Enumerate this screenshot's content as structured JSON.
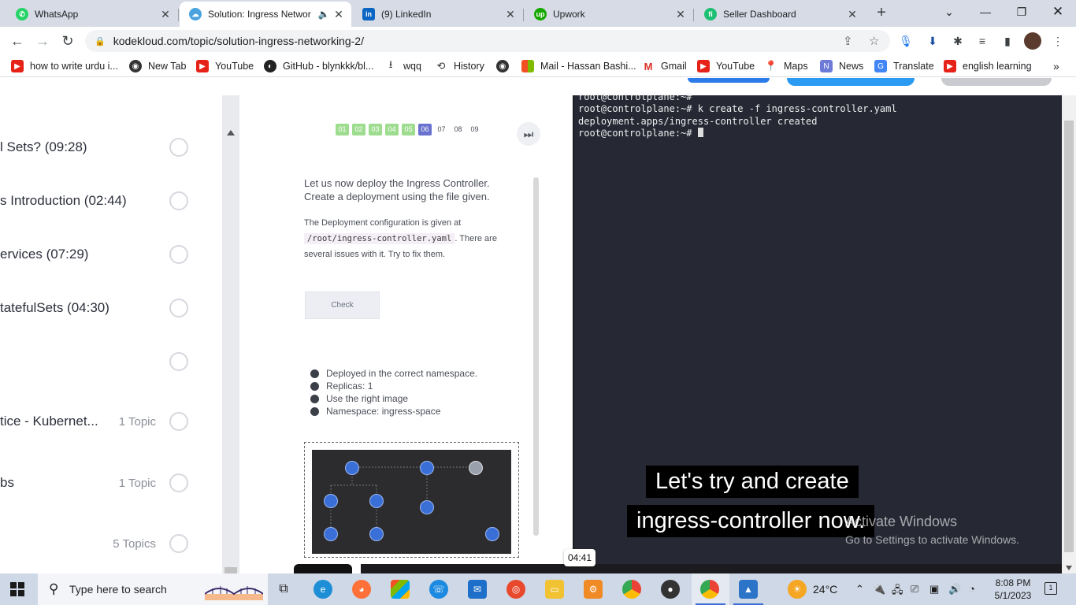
{
  "browser": {
    "tabs": [
      {
        "title": "WhatsApp",
        "icon": "whatsapp-icon",
        "color": "#25d366"
      },
      {
        "title": "Solution: Ingress Networ",
        "icon": "kodekloud-icon",
        "color": "#1e90ff",
        "active": true,
        "audio": true
      },
      {
        "title": "(9) LinkedIn",
        "icon": "linkedin-icon",
        "color": "#0a66c2"
      },
      {
        "title": "Upwork",
        "icon": "upwork-icon",
        "color": "#14a800"
      },
      {
        "title": "Seller Dashboard",
        "icon": "fiverr-icon",
        "color": "#1dbf73"
      }
    ],
    "url": "kodekloud.com/topic/solution-ingress-networking-2/",
    "bookmarks": [
      {
        "label": "how to write urdu i...",
        "icon": "youtube-icon"
      },
      {
        "label": "New Tab",
        "icon": "globe-icon"
      },
      {
        "label": "YouTube",
        "icon": "youtube-icon"
      },
      {
        "label": "GitHub - blynkkk/bl...",
        "icon": "github-icon"
      },
      {
        "label": "wqq",
        "icon": "download-icon"
      },
      {
        "label": "History",
        "icon": "history-icon"
      },
      {
        "label": "",
        "icon": "globe-icon"
      },
      {
        "label": "Mail - Hassan Bashi...",
        "icon": "microsoft-icon"
      },
      {
        "label": "Gmail",
        "icon": "gmail-icon"
      },
      {
        "label": "YouTube",
        "icon": "youtube-icon"
      },
      {
        "label": "Maps",
        "icon": "maps-icon"
      },
      {
        "label": "News",
        "icon": "news-icon"
      },
      {
        "label": "Translate",
        "icon": "translate-icon"
      },
      {
        "label": "english learning",
        "icon": "youtube-icon"
      }
    ]
  },
  "lessons": [
    {
      "title": "l Sets? (09:28)",
      "topics": ""
    },
    {
      "title": "s Introduction (02:44)",
      "topics": ""
    },
    {
      "title": "ervices (07:29)",
      "topics": ""
    },
    {
      "title": "tatefulSets (04:30)",
      "topics": ""
    },
    {
      "title": "",
      "topics": ""
    },
    {
      "title": "tice - Kubernet...",
      "topics": "1 Topic"
    },
    {
      "title": "bs",
      "topics": "1 Topic"
    },
    {
      "title": "",
      "topics": "5 Topics"
    }
  ],
  "lab": {
    "questions": [
      "01",
      "02",
      "03",
      "04",
      "05",
      "06",
      "07",
      "08",
      "09"
    ],
    "current": "06",
    "intro": "Let us now deploy the Ingress Controller. Create a deployment using the file given.",
    "config_pre": "The Deployment configuration is given at",
    "config_path": "/root/ingress-controller.yaml",
    "config_post": ". There are several issues with it. Try to fix them.",
    "check_label": "Check",
    "tasks": [
      "Deployed in the correct namespace.",
      "Replicas: 1",
      "Use the right image",
      "Namespace: ingress-space"
    ]
  },
  "terminal": {
    "lines": [
      "root@controlplane:~#",
      "root@controlplane:~# k create -f ingress-controller.yaml",
      "deployment.apps/ingress-controller created",
      "root@controlplane:~# "
    ]
  },
  "video": {
    "subtitle_line1": "Let's try and create",
    "subtitle_line2": "ingress-controller now.",
    "time": "04:41"
  },
  "watermark": {
    "line1": "Activate Windows",
    "line2": "Go to Settings to activate Windows."
  },
  "taskbar": {
    "search_placeholder": "Type here to search",
    "weather": "24°C",
    "time": "8:08 PM",
    "date": "5/1/2023",
    "notifications": "1"
  }
}
